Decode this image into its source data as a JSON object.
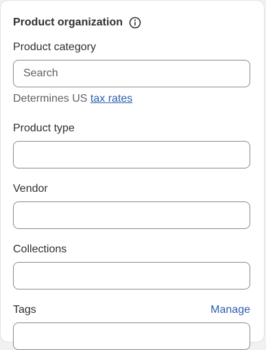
{
  "card": {
    "title": "Product organization",
    "info_icon": "info-circle-icon"
  },
  "category": {
    "label": "Product category",
    "placeholder": "Search",
    "helper_prefix": "Determines US ",
    "helper_link": "tax rates"
  },
  "product_type": {
    "label": "Product type",
    "value": ""
  },
  "vendor": {
    "label": "Vendor",
    "value": ""
  },
  "collections": {
    "label": "Collections",
    "value": ""
  },
  "tags": {
    "label": "Tags",
    "manage_link": "Manage",
    "value": ""
  },
  "colors": {
    "link": "#2a5fb0",
    "border": "#8a8a8a",
    "text": "#303030"
  }
}
